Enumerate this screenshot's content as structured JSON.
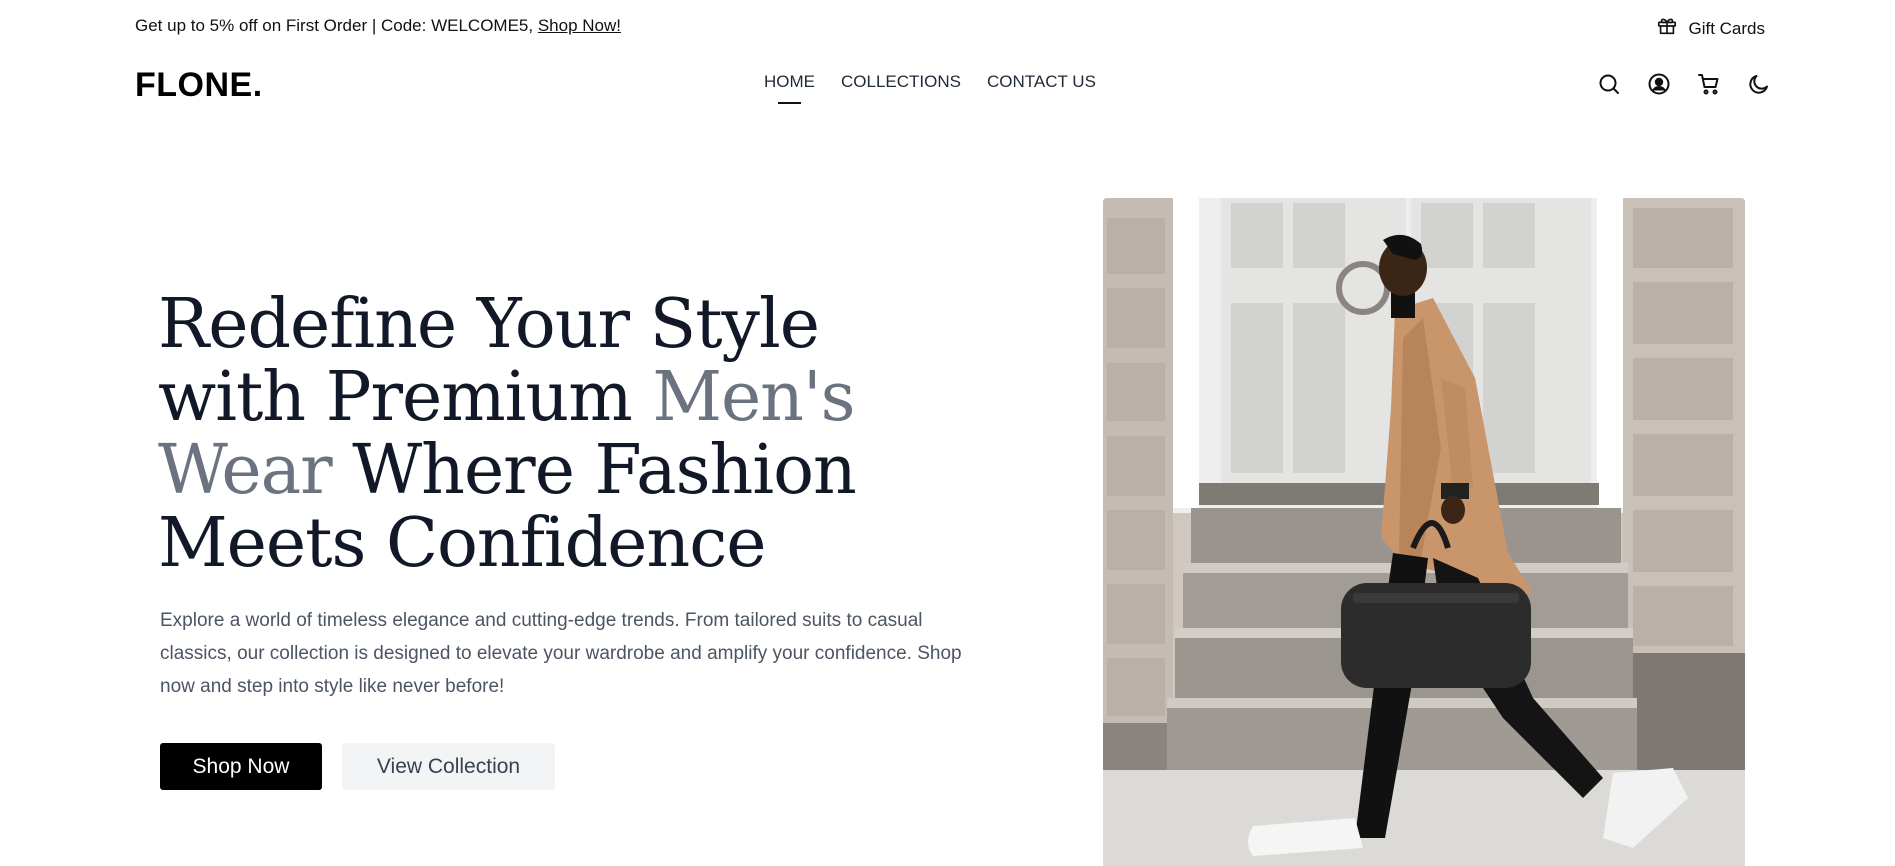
{
  "announcement": {
    "text": "Get up to 5% off on First Order | Code: WELCOME5,",
    "link": "Shop Now!",
    "gift_icon": "gift-icon",
    "gift_label": "Gift Cards"
  },
  "header": {
    "logo": "FLONE.",
    "nav": [
      {
        "label": "HOME",
        "active": true
      },
      {
        "label": "COLLECTIONS",
        "active": false
      },
      {
        "label": "CONTACT US",
        "active": false
      }
    ],
    "icons": [
      "search-icon",
      "user-icon",
      "cart-icon",
      "moon-icon"
    ]
  },
  "hero": {
    "title_part1": "Redefine Your Style with Premium ",
    "title_highlight": "Men's Wear",
    "title_part2": " Where Fashion Meets Confidence",
    "description": "Explore a world of timeless elegance and cutting-edge trends. From tailored suits to casual classics, our collection is designed to elevate your wardrobe and amplify your confidence. Shop now and step into style like never before!",
    "primary_button": "Shop Now",
    "secondary_button": "View Collection"
  },
  "colors": {
    "primary": "#000000",
    "heading": "#111827",
    "muted": "#6b7280",
    "secondary_bg": "#f3f4f6"
  }
}
